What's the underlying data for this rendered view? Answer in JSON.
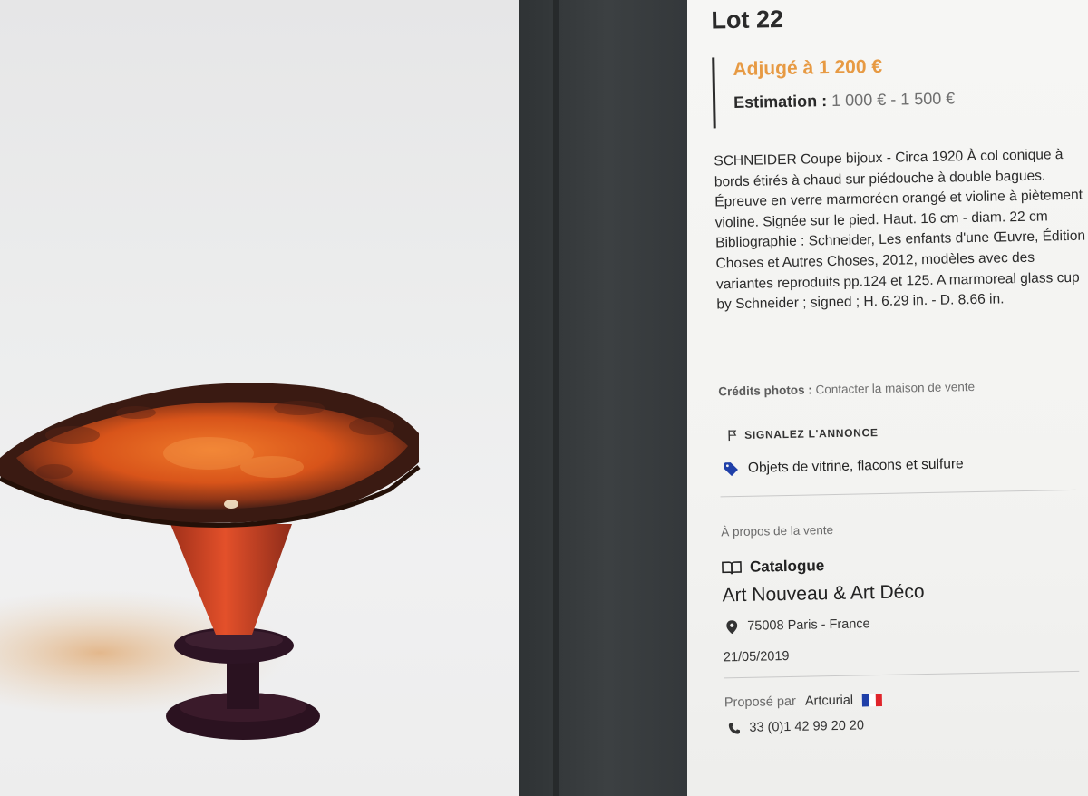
{
  "lot": {
    "title": "Lot 22",
    "adjuge": "Adjugé à 1 200 €",
    "estimation_label": "Estimation :",
    "estimation_value": " 1 000 € - 1 500 €"
  },
  "description": "SCHNEIDER  Coupe bijoux - Circa 1920  À col conique à bords étirés à chaud sur piédouche à double bagues. Épreuve en verre marmoréen orangé et violine à piètement violine.  Signée sur le pied.  Haut. 16 cm - diam. 22 cm   Bibliographie : Schneider, Les enfants d'une Œuvre, Édition Choses et Autres Choses, 2012, modèles avec des variantes reproduits pp.124 et 125.   A marmoreal glass cup by Schneider ; signed ;  H. 6.29 in. - D. 8.66 in.",
  "credits": {
    "label": "Crédits photos :",
    "value": " Contacter la maison de vente"
  },
  "report_label": "SIGNALEZ L'ANNONCE",
  "category_label": "Objets de vitrine, flacons et sulfure",
  "sale": {
    "about": "À propos de la vente",
    "catalogue_label": "Catalogue",
    "title": "Art Nouveau & Art Déco",
    "location": "75008 Paris - France",
    "date": "21/05/2019"
  },
  "house": {
    "proposed_by_label": "Proposé par",
    "name": "Artcurial",
    "phone": "33 (0)1 42 99 20 20"
  },
  "icons": {
    "report": "flag-icon",
    "category": "tag-icon",
    "catalogue": "book-icon",
    "location": "map-pin-icon",
    "phone": "phone-icon"
  },
  "colors": {
    "adjuge": "#e79a43",
    "tag": "#1f3fa8",
    "flag_blue": "#1f3fa8",
    "flag_white": "#ffffff",
    "flag_red": "#e0252b"
  }
}
